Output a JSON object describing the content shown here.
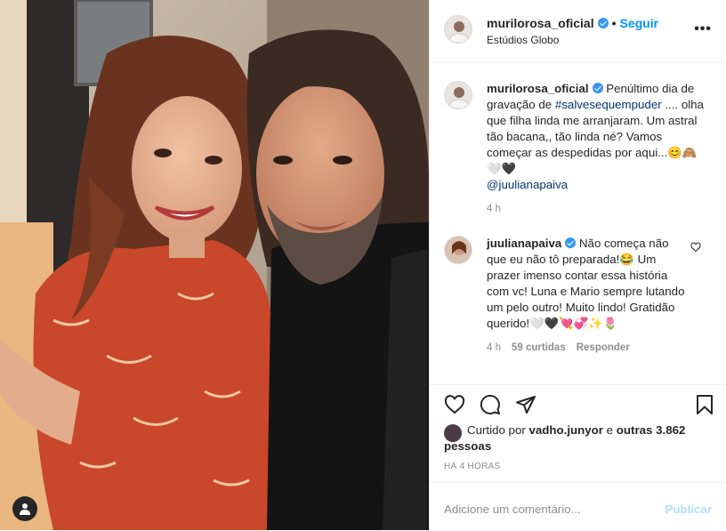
{
  "header": {
    "username": "murilorosa_oficial",
    "follow_label": "Seguir",
    "location": "Estúdios Globo",
    "more_label": "•••"
  },
  "caption": {
    "username": "murilorosa_oficial",
    "text_before_tag": "Penúltimo dia de gravação de",
    "hashtag": "#salvesequempuder",
    "text_after_tag": ".... olha que filha linda me arranjaram. Um astral tão bacana,, tão linda né? Vamos começar as despedidas por aqui...😊🙈🤍🖤",
    "mention": "@juulianapaiva",
    "time": "4 h"
  },
  "reply": {
    "username": "juulianapaiva",
    "text": "Não começa não que eu não tô preparada!😂 Um prazer imenso contar essa história com vc! Luna e Mario sempre lutando um pelo outro! Muito lindo! Gratidão querido!🤍🖤💘💞✨🌷",
    "time": "4 h",
    "likes": "59 curtidas",
    "reply_label": "Responder"
  },
  "likes": {
    "liked_by_prefix": "Curtido por",
    "liked_by_user": "vadho.junyor",
    "and_label": "e",
    "others": "outras 3.862 pessoas"
  },
  "timestamp": "HÁ 4 HORAS",
  "comment_box": {
    "placeholder": "Adicione um comentário...",
    "post_label": "Publicar"
  },
  "icons": [
    "heart-icon",
    "comment-icon",
    "share-icon",
    "bookmark-icon",
    "person-tag-icon",
    "more-icon",
    "verified-icon"
  ],
  "colors": {
    "link": "#00376b",
    "follow": "#0095f6",
    "verified": "#3897f0",
    "muted": "#8e8e8e",
    "publish_disabled": "#b2dffc"
  }
}
